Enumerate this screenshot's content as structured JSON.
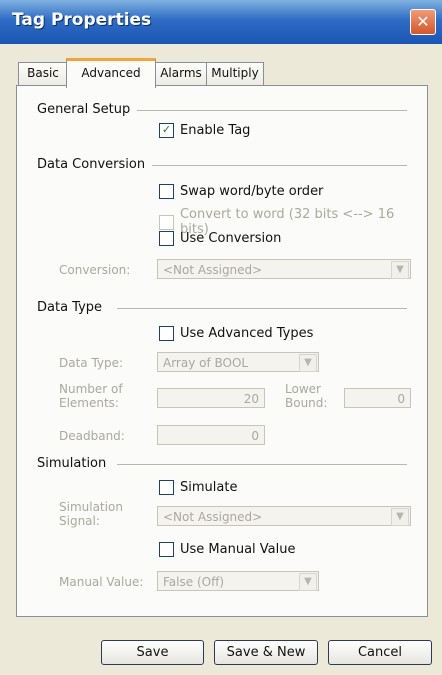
{
  "window": {
    "title": "Tag Properties"
  },
  "tabs": [
    {
      "label": "Basic"
    },
    {
      "label": "Advanced"
    },
    {
      "label": "Alarms"
    },
    {
      "label": "Multiply"
    }
  ],
  "general_setup": {
    "heading": "General Setup",
    "enable_tag": {
      "label": "Enable Tag",
      "checked": true
    }
  },
  "data_conversion": {
    "heading": "Data Conversion",
    "swap_order": {
      "label": "Swap word/byte order",
      "checked": false
    },
    "convert_to_word": {
      "label": "Convert to word (32 bits <--> 16 bits)",
      "checked": false
    },
    "use_conversion": {
      "label": "Use Conversion",
      "checked": false
    },
    "conversion_label": "Conversion:",
    "conversion_value": "<Not Assigned>"
  },
  "data_type": {
    "heading": "Data Type",
    "use_advanced_types": {
      "label": "Use Advanced Types",
      "checked": false
    },
    "data_type_label": "Data Type:",
    "data_type_value": "Array of BOOL",
    "number_of_elements_label": "Number of Elements:",
    "number_of_elements_value": "20",
    "lower_bound_label": "Lower Bound:",
    "lower_bound_value": "0",
    "deadband_label": "Deadband:",
    "deadband_value": "0"
  },
  "simulation": {
    "heading": "Simulation",
    "simulate": {
      "label": "Simulate",
      "checked": false
    },
    "signal_label": "Simulation Signal:",
    "signal_value": "<Not Assigned>",
    "use_manual_value": {
      "label": "Use Manual Value",
      "checked": false
    },
    "manual_value_label": "Manual Value:",
    "manual_value_value": "False (Off)"
  },
  "buttons": {
    "save": "Save",
    "save_new": "Save & New",
    "cancel": "Cancel"
  }
}
